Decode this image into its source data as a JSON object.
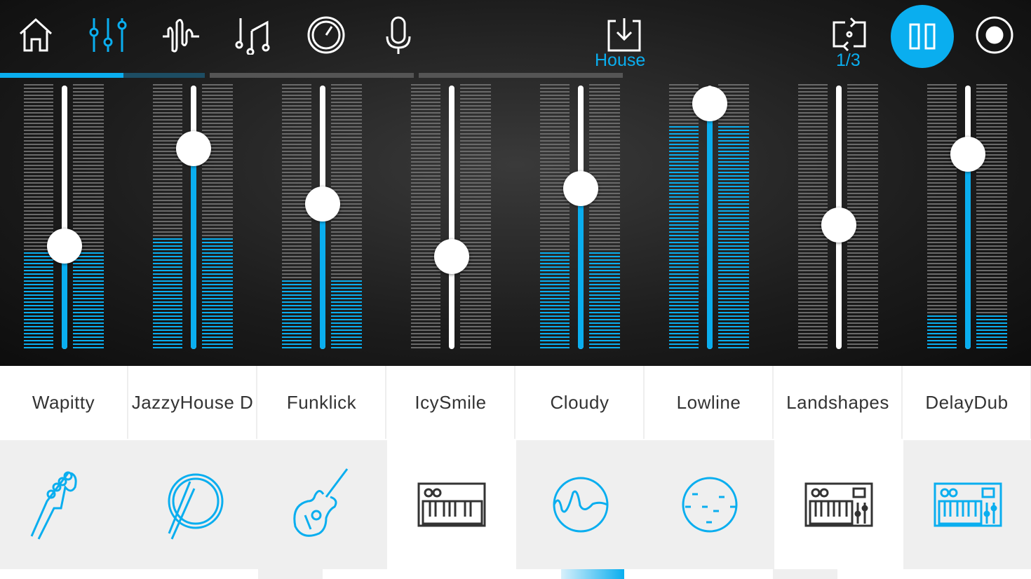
{
  "toolbar": {
    "icons": [
      "home-icon",
      "mixer-icon",
      "waveform-icon",
      "music-notes-icon",
      "knob-icon",
      "microphone-icon"
    ],
    "active": "mixer-icon",
    "preset_label": "House",
    "loop_counter": "1/3",
    "accent": "#0aaeef"
  },
  "progress": {
    "segments": 4,
    "current_segment_fill": 0.6
  },
  "channels": [
    {
      "name": "Wapitty",
      "volume": 0.39,
      "level": 0.37,
      "active": true,
      "instrument": "bass-guitar-icon"
    },
    {
      "name": "JazzyHouse D",
      "volume": 0.76,
      "level": 0.43,
      "active": true,
      "instrument": "drum-icon"
    },
    {
      "name": "Funklick",
      "volume": 0.55,
      "level": 0.26,
      "active": true,
      "instrument": "acoustic-guitar-icon"
    },
    {
      "name": "IcySmile",
      "volume": 0.35,
      "level": 0,
      "active": false,
      "instrument": "keyboard-icon"
    },
    {
      "name": "Cloudy",
      "volume": 0.61,
      "level": 0.37,
      "active": true,
      "instrument": "wave-circle-icon"
    },
    {
      "name": "Lowline",
      "volume": 0.93,
      "level": 0.85,
      "active": true,
      "instrument": "dashes-circle-icon"
    },
    {
      "name": "Landshapes",
      "volume": 0.47,
      "level": 0,
      "active": false,
      "instrument": "synth-icon"
    },
    {
      "name": "DelayDub",
      "volume": 0.74,
      "level": 0.13,
      "active": true,
      "instrument": "synth-icon"
    }
  ]
}
